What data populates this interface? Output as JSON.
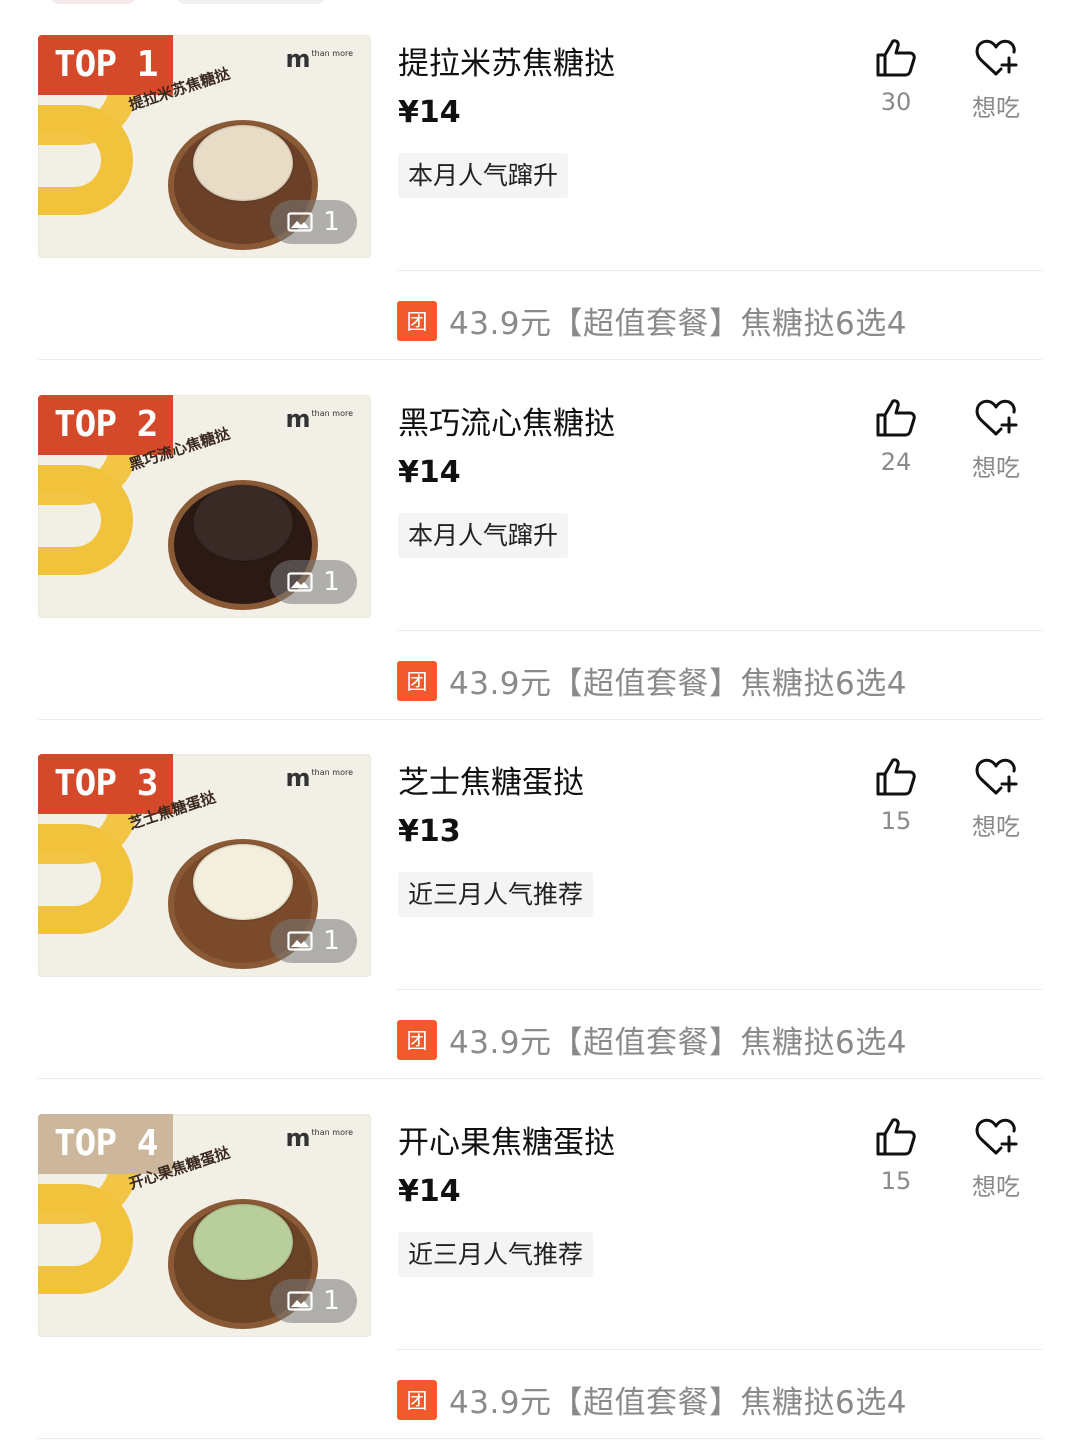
{
  "items": [
    {
      "rank": "TOP 1",
      "rank_muted": false,
      "image_caption": "提拉米苏焦糖挞",
      "photo_count": "1",
      "title": "提拉米苏焦糖挞",
      "price": "¥14",
      "tag": "本月人气蹿升",
      "likes": "30",
      "want_label": "想吃",
      "deal_badge": "团",
      "deal_text": "43.9元【超值套餐】焦糖挞6选4",
      "tart_color": "#6b4028",
      "topping_color": "#e9dcc6"
    },
    {
      "rank": "TOP 2",
      "rank_muted": false,
      "image_caption": "黑巧流心焦糖挞",
      "photo_count": "1",
      "title": "黑巧流心焦糖挞",
      "price": "¥14",
      "tag": "本月人气蹿升",
      "likes": "24",
      "want_label": "想吃",
      "deal_badge": "团",
      "deal_text": "43.9元【超值套餐】焦糖挞6选4",
      "tart_color": "#2b1a14",
      "topping_color": "#3a2a26"
    },
    {
      "rank": "TOP 3",
      "rank_muted": false,
      "image_caption": "芝士焦糖蛋挞",
      "photo_count": "1",
      "title": "芝士焦糖蛋挞",
      "price": "¥13",
      "tag": "近三月人气推荐",
      "likes": "15",
      "want_label": "想吃",
      "deal_badge": "团",
      "deal_text": "43.9元【超值套餐】焦糖挞6选4",
      "tart_color": "#7a4a2a",
      "topping_color": "#f3efdc"
    },
    {
      "rank": "TOP 4",
      "rank_muted": true,
      "image_caption": "开心果焦糖蛋挞",
      "photo_count": "1",
      "title": "开心果焦糖蛋挞",
      "price": "¥14",
      "tag": "近三月人气推荐",
      "likes": "15",
      "want_label": "想吃",
      "deal_badge": "团",
      "deal_text": "43.9元【超值套餐】焦糖挞6选4",
      "tart_color": "#6a4226",
      "topping_color": "#b9cf9b"
    }
  ],
  "brand": {
    "mark": "m",
    "small": "than more"
  },
  "colors": {
    "accent": "#d4492a",
    "deal": "#f15a2c",
    "yellow": "#f1c23c"
  },
  "icons": {
    "like": "thumbs-up-icon",
    "want": "heart-plus-icon",
    "photo": "image-icon"
  }
}
